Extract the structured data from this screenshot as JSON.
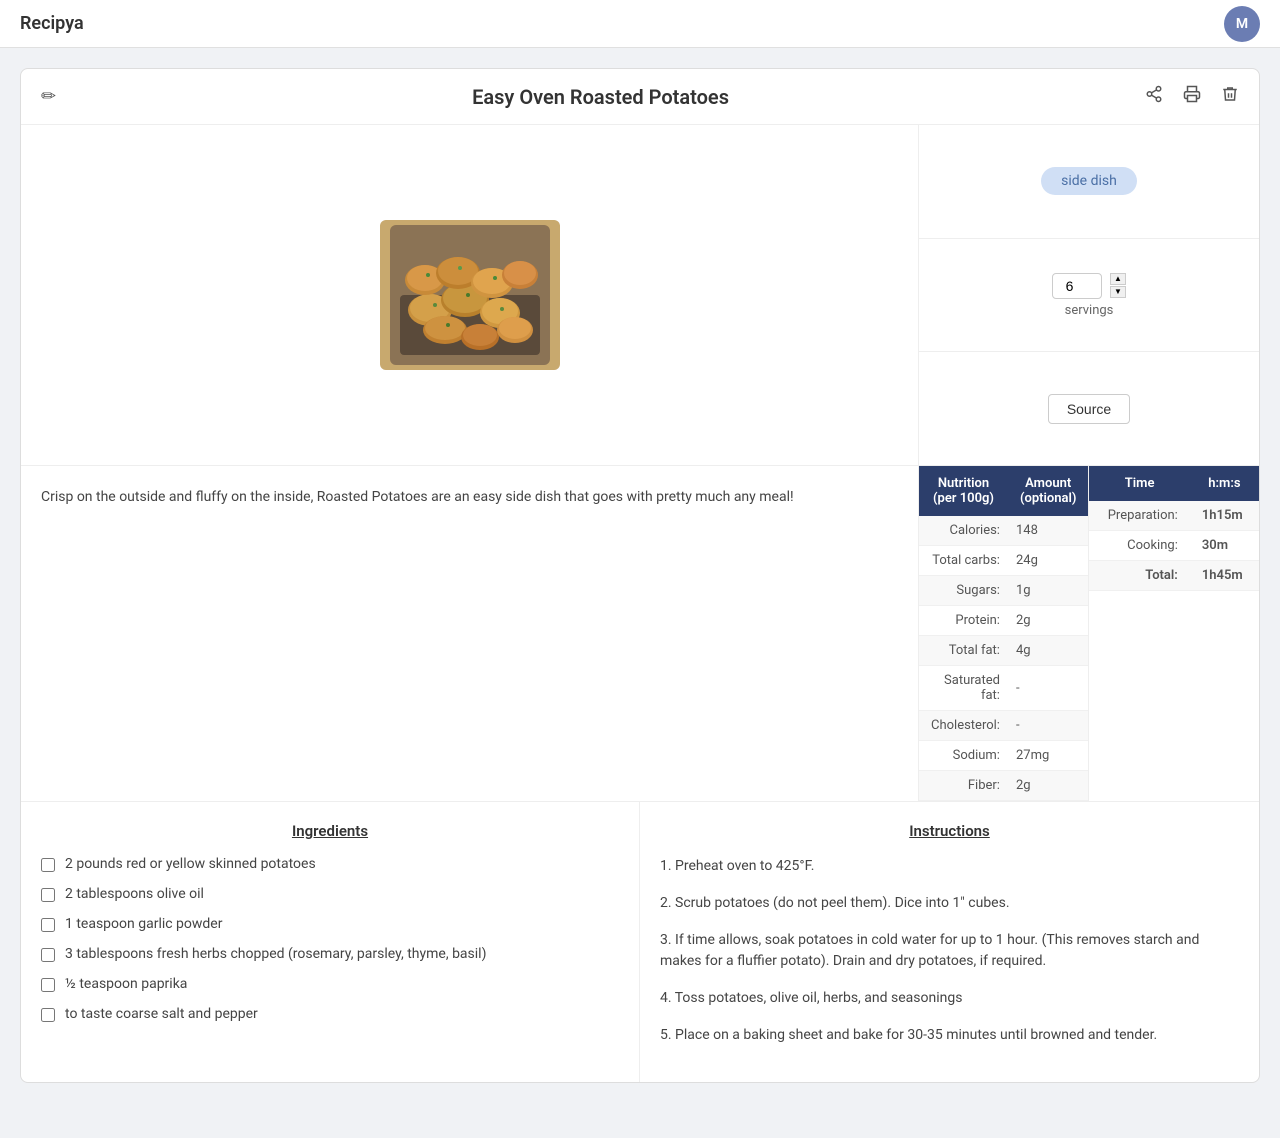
{
  "app": {
    "title": "Recipya",
    "user_initial": "M"
  },
  "recipe": {
    "title": "Easy Oven Roasted Potatoes",
    "tag": "side dish",
    "servings": 6,
    "servings_label": "servings",
    "source_label": "Source",
    "description": "Crisp on the outside and fluffy on the inside, Roasted Potatoes are an easy side dish that goes with pretty much any meal!",
    "nutrition": {
      "header_col1": "Nutrition\n(per 100g)",
      "header_col2": "Amount\n(optional)",
      "rows": [
        {
          "label": "Calories:",
          "value": "148"
        },
        {
          "label": "Total carbs:",
          "value": "24g"
        },
        {
          "label": "Sugars:",
          "value": "1g"
        },
        {
          "label": "Protein:",
          "value": "2g"
        },
        {
          "label": "Total fat:",
          "value": "4g"
        },
        {
          "label": "Saturated fat:",
          "value": "-"
        },
        {
          "label": "Cholesterol:",
          "value": "-"
        },
        {
          "label": "Sodium:",
          "value": "27mg"
        },
        {
          "label": "Fiber:",
          "value": "2g"
        }
      ]
    },
    "time": {
      "header_col1": "Time",
      "header_col2": "h:m:s",
      "rows": [
        {
          "label": "Preparation:",
          "value": "1h15m"
        },
        {
          "label": "Cooking:",
          "value": "30m"
        },
        {
          "label": "Total:",
          "value": "1h45m"
        }
      ]
    },
    "ingredients_title": "Ingredients",
    "ingredients": [
      "2 pounds red or yellow skinned potatoes",
      "2 tablespoons olive oil",
      "1 teaspoon garlic powder",
      "3 tablespoons fresh herbs chopped (rosemary, parsley, thyme, basil)",
      "½ teaspoon paprika",
      "to taste coarse salt and pepper"
    ],
    "instructions_title": "Instructions",
    "instructions": [
      "1. Preheat oven to 425°F.",
      "2. Scrub potatoes (do not peel them). Dice into 1\" cubes.",
      "3. If time allows, soak potatoes in cold water for up to 1 hour. (This removes starch and makes for a fluffier potato). Drain and dry potatoes, if required.",
      "4. Toss potatoes, olive oil, herbs, and seasonings",
      "5. Place on a baking sheet and bake for 30-35 minutes until browned and tender."
    ]
  },
  "icons": {
    "edit": "✏",
    "share": "↗",
    "print": "🖨",
    "delete": "🗑",
    "chevron_up": "▲",
    "chevron_down": "▼"
  }
}
